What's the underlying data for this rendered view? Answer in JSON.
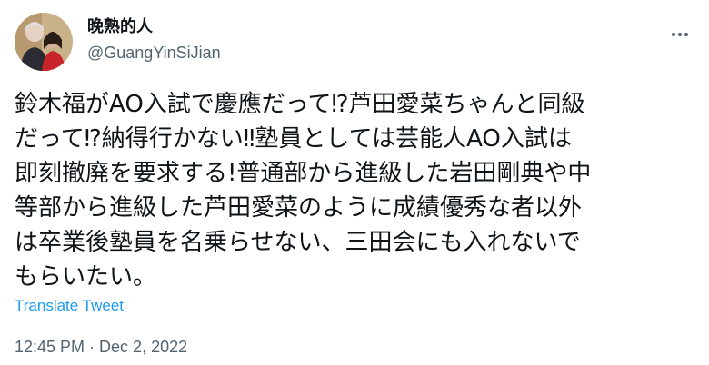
{
  "tweet": {
    "display_name": "晚熟的人",
    "handle": "@GuangYinSiJian",
    "text": "鈴木福がAO入試で慶應だって⁉芦田愛菜ちゃんと同級\nだって⁉納得行かない‼塾員としては芸能人AO入試は\n即刻撤廃を要求する!普通部から進級した岩田剛典や中\n等部から進級した芦田愛菜のように成績優秀な者以外\nは卒業後塾員を名乗らせない、三田会にも入れないで\nもらいたい。",
    "translate_label": "Translate Tweet",
    "timestamp": "12:45 PM · Dec 2, 2022"
  },
  "icons": {
    "avatar": "profile-photo",
    "more": "more-options-icon"
  },
  "colors": {
    "text": "#0f1419",
    "secondary": "#536471",
    "link": "#1d9bf0"
  }
}
